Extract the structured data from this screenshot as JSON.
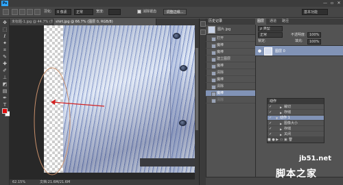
{
  "app": {
    "logo": "Ps",
    "window_controls": [
      "—",
      "▫",
      "✕"
    ]
  },
  "options_bar": {
    "feather_label": "羽化:",
    "feather_value": "0 像素",
    "mode_value": "正常",
    "width_label": "宽度:",
    "height_label": "高度:",
    "antialias_label": "消除锯齿",
    "refine_edge_button": "调整边缘...",
    "workspace_value": "基本功能"
  },
  "doc_tabs": [
    {
      "label": "未标题-1.jpg @ 44.7% (背景, RGB/8)",
      "active": false
    },
    {
      "label": "shirt.jpg @ 66.7% (图层 0, RGB/8)",
      "active": true
    }
  ],
  "status_bar": {
    "zoom": "62.15%",
    "doc_info": "文档:21.6M/21.6M"
  },
  "history_panel": {
    "title": "历史记录",
    "snapshot_label": "图片.jpg",
    "items": [
      {
        "label": "打开",
        "state": "normal"
      },
      {
        "label": "魔棒",
        "state": "normal"
      },
      {
        "label": "魔棒",
        "state": "normal"
      },
      {
        "label": "建立图层",
        "state": "normal"
      },
      {
        "label": "魔棒",
        "state": "normal"
      },
      {
        "label": "清除",
        "state": "normal"
      },
      {
        "label": "魔棒",
        "state": "normal"
      },
      {
        "label": "清除",
        "state": "normal"
      },
      {
        "label": "魔棒",
        "state": "selected"
      },
      {
        "label": "清除",
        "state": "undone"
      }
    ]
  },
  "layers_panel": {
    "tabs": [
      {
        "label": "图层",
        "active": true
      },
      {
        "label": "通道",
        "active": false
      },
      {
        "label": "路径",
        "active": false
      }
    ],
    "kind_value": "ρ 类型",
    "blend_mode": "正常",
    "opacity_label": "不透明度:",
    "opacity_value": "100%",
    "lock_label": "锁定:",
    "fill_label": "填充:",
    "fill_value": "100%",
    "layer_name": "图层 0"
  },
  "actions_panel": {
    "title": "动作",
    "items": [
      {
        "label": "裁切",
        "indent": 1,
        "state": "normal"
      },
      {
        "label": "存储",
        "indent": 1,
        "state": "normal"
      },
      {
        "label": "动作 1",
        "indent": 0,
        "state": "selected"
      },
      {
        "label": "图像大小",
        "indent": 1,
        "state": "normal"
      },
      {
        "label": "存储",
        "indent": 1,
        "state": "normal"
      },
      {
        "label": "关闭",
        "indent": 1,
        "state": "normal"
      }
    ],
    "footer_icons": "■ ● ▶ ▭ ▣ 🗑"
  },
  "watermark": {
    "domain": "jb51.net",
    "chinese": "脚本之家"
  },
  "colors": {
    "foreground": "#e00c0c",
    "background": "#ffffff",
    "selection": "#8193b6",
    "accent": "#31a8ff"
  }
}
